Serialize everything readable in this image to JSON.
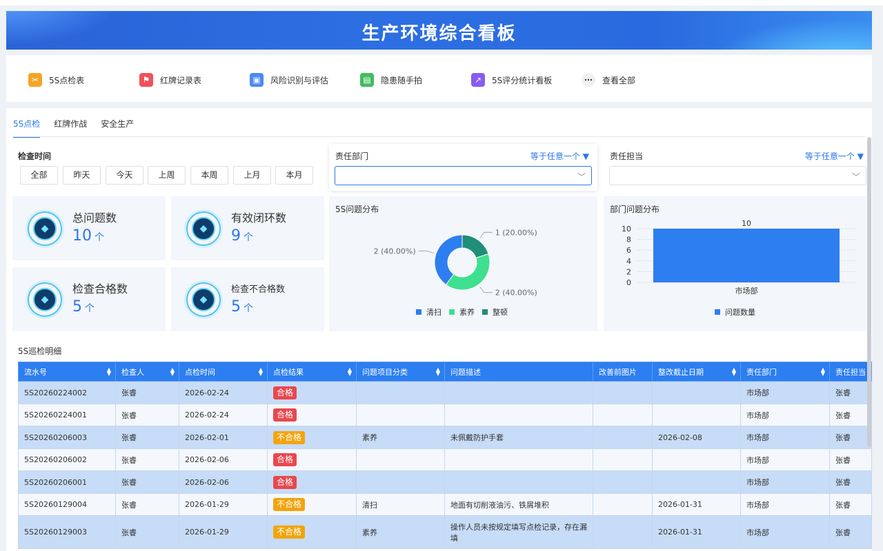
{
  "header": {
    "title": "生产环境综合看板"
  },
  "shortcuts": [
    {
      "label": "5S点检表",
      "icon": "tools-icon",
      "glyph": "✂",
      "color": "#f5a524"
    },
    {
      "label": "红牌记录表",
      "icon": "flag-icon",
      "glyph": "⚑",
      "color": "#f0525a"
    },
    {
      "label": "风险识别与评估",
      "icon": "briefcase-icon",
      "glyph": "▣",
      "color": "#4a8af4"
    },
    {
      "label": "隐患随手拍",
      "icon": "photo-icon",
      "glyph": "▤",
      "color": "#3ebd5c"
    },
    {
      "label": "5S评分统计看板",
      "icon": "trend-chart-icon",
      "glyph": "↗",
      "color": "#8a5cf2"
    },
    {
      "label": "查看全部",
      "icon": "more-icon",
      "glyph": "⋯",
      "color": "#f0f1f4"
    }
  ],
  "tabs": [
    "5S点检",
    "红牌作战",
    "安全生产"
  ],
  "filters": {
    "time_label": "检查时间",
    "time_buttons": [
      "全部",
      "昨天",
      "今天",
      "上周",
      "本周",
      "上月",
      "本月"
    ],
    "dept": {
      "label": "责任部门",
      "operator": "等于任意一个"
    },
    "owner": {
      "label": "责任担当",
      "operator": "等于任意一个"
    }
  },
  "kpis": [
    {
      "label": "总问题数",
      "value": "10",
      "unit": "个"
    },
    {
      "label": "有效闭环数",
      "value": "9",
      "unit": "个"
    },
    {
      "label": "检查合格数",
      "value": "5",
      "unit": "个"
    },
    {
      "label": "检查不合格数",
      "value": "5",
      "unit": "个"
    }
  ],
  "chart_data": [
    {
      "type": "pie",
      "title": "5S问题分布",
      "categories": [
        "清扫",
        "素养",
        "整顿"
      ],
      "values": [
        2,
        2,
        1
      ],
      "data_labels": [
        "2 (40.00%)",
        "2 (40.00%)",
        "1 (20.00%)"
      ],
      "colors": [
        "#2d7ef0",
        "#3ee08f",
        "#1f8f78"
      ],
      "legend": "bottom"
    },
    {
      "type": "bar",
      "title": "部门问题分布",
      "categories": [
        "市场部"
      ],
      "series": [
        {
          "name": "问题数量",
          "values": [
            10
          ]
        }
      ],
      "ylim": [
        0,
        10
      ],
      "yticks": [
        "0",
        "2",
        "4",
        "6",
        "8",
        "10"
      ],
      "color": "#2d7ef0",
      "legend": "bottom"
    }
  ],
  "table": {
    "title": "5S巡检明细",
    "columns": [
      "流水号",
      "检查人",
      "点检时间",
      "点检结果",
      "问题项目分类",
      "问题描述",
      "改善前图片",
      "整改截止日期",
      "责任部门",
      "责任担当"
    ],
    "rows": [
      [
        "5S20260224002",
        "张睿",
        "2026-02-24",
        "合格",
        "",
        "",
        "",
        "",
        "市场部",
        "张睿"
      ],
      [
        "5S20260224001",
        "张睿",
        "2026-02-24",
        "合格",
        "",
        "",
        "",
        "",
        "市场部",
        "张睿"
      ],
      [
        "5S20260206003",
        "张睿",
        "2026-02-01",
        "不合格",
        "素养",
        "未佩戴防护手套",
        "",
        "2026-02-08",
        "市场部",
        "张睿"
      ],
      [
        "5S20260206002",
        "张睿",
        "2026-02-06",
        "合格",
        "",
        "",
        "",
        "",
        "市场部",
        "张睿"
      ],
      [
        "5S20260206001",
        "张睿",
        "2026-02-06",
        "合格",
        "",
        "",
        "",
        "",
        "市场部",
        "张睿"
      ],
      [
        "5S20260129004",
        "张睿",
        "2026-01-29",
        "不合格",
        "清扫",
        "地面有切削液油污、铁屑堆积",
        "",
        "2026-01-31",
        "市场部",
        "张睿"
      ],
      [
        "5S20260129003",
        "张睿",
        "2026-01-29",
        "不合格",
        "素养",
        "操作人员未按规定填写点检记录，存在漏填",
        "",
        "2026-01-31",
        "市场部",
        "张睿"
      ]
    ]
  }
}
